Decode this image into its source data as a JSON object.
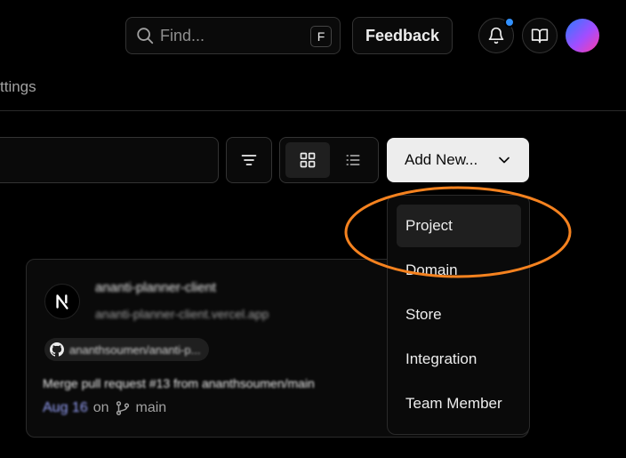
{
  "header": {
    "search_placeholder": "Find...",
    "search_shortcut": "F",
    "feedback_label": "Feedback"
  },
  "nav": {
    "visible_tab": "ttings"
  },
  "toolbar": {
    "add_new_label": "Add New..."
  },
  "menu": {
    "items": [
      "Project",
      "Domain",
      "Store",
      "Integration",
      "Team Member"
    ],
    "active_index": 0
  },
  "project_card": {
    "name": "ananti-planner-client",
    "url": "ananti-planner-client.vercel.app",
    "repo": "ananthsoumen/ananti-p...",
    "commit_message": "Merge pull request #13 from ananthsoumen/main",
    "commit_time": "Aug 16",
    "on_label": "on",
    "branch": "main"
  },
  "colors": {
    "notification_dot": "#3291ff",
    "annotation": "#f5821f",
    "add_new_bg": "#ededed"
  }
}
